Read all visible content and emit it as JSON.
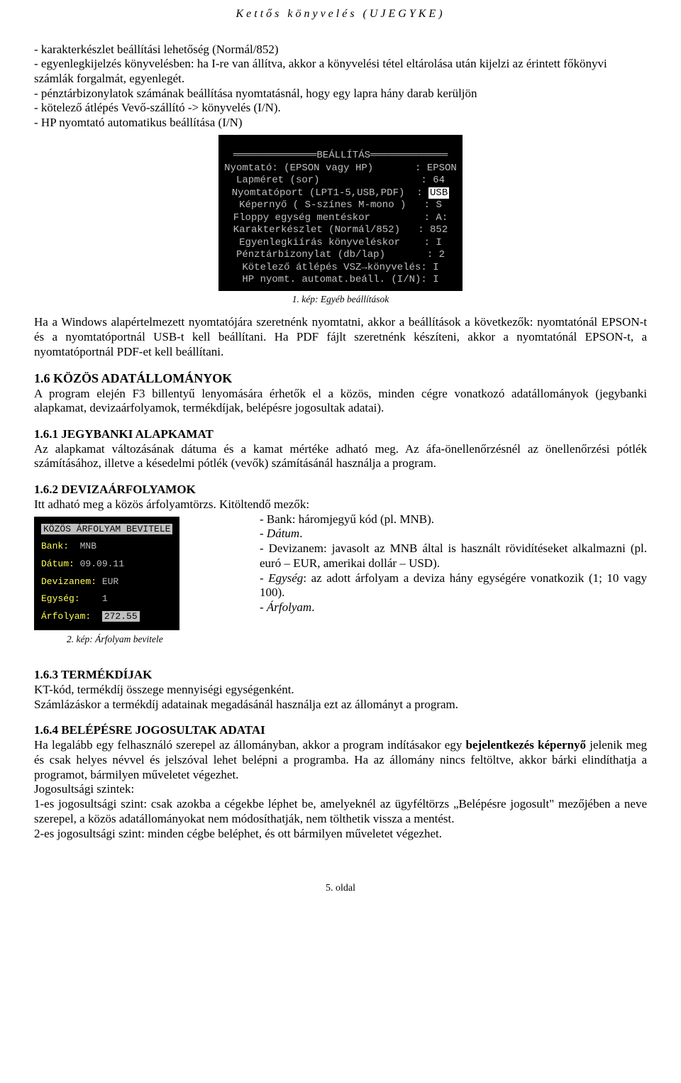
{
  "header": "Kettős könyvelés (UJEGYKE)",
  "intro_bullets": [
    "karakterkészlet beállítási lehetőség (Normál/852)",
    "egyenlegkijelzés könyvelésben: ha I-re van állítva, akkor a könyvelési tétel eltárolása után kijelzi az érintett főkönyvi számlák forgalmát, egyenlegét.",
    "pénztárbizonylatok számának beállítása nyomtatásnál, hogy egy lapra hány darab kerüljön",
    "kötelező átlépés Vevő-szállító -> könyvelés (I/N).",
    "HP nyomtató automatikus beállítása (I/N)"
  ],
  "dos1": {
    "title": "══════════════BEÁLLÍTÁS═════════════",
    "rows": [
      {
        "label": "Nyomtató: (EPSON vagy HP)",
        "sep": ":",
        "val": "EPSON"
      },
      {
        "label": "Lapméret (sor)",
        "sep": ":",
        "val": "64"
      },
      {
        "label": "Nyomtatóport (LPT1-5,USB,PDF)",
        "sep": ":",
        "val": "USB",
        "hl": true
      },
      {
        "label": "Képernyő ( S-színes M-mono )",
        "sep": ":",
        "val": "S"
      },
      {
        "label": "Floppy egység mentéskor",
        "sep": ":",
        "val": "A:"
      },
      {
        "label": "Karakterkészlet (Normál/852)",
        "sep": ":",
        "val": "852"
      },
      {
        "label": "Egyenlegkiírás könyveléskor",
        "sep": ":",
        "val": "I"
      },
      {
        "label": "Pénztárbizonylat (db/lap)",
        "sep": ":",
        "val": "2"
      },
      {
        "label": "Kötelező átlépés VSZ→könyvelés:",
        "sep": "",
        "val": "I"
      },
      {
        "label": "HP nyomt. automat.beáll. (I/N):",
        "sep": "",
        "val": "I"
      }
    ]
  },
  "caption1": "1. kép: Egyéb beállítások",
  "para1": "Ha a Windows alapértelmezett nyomtatójára szeretnénk nyomtatni, akkor a beállítások a következők: nyomtatónál EPSON-t és a nyomtatóportnál USB-t kell beállítani. Ha PDF fájlt szeretnénk készíteni, akkor a nyomtatónál EPSON-t, a nyomtatóportnál PDF-et kell beállítani.",
  "sec16_title": "1.6   KÖZÖS ADATÁLLOMÁNYOK",
  "sec16_body": "A program elején F3 billentyű lenyomására érhetők el a közös, minden cégre vonatkozó adatállományok (jegybanki alapkamat, devizaárfolyamok, termékdíjak, belépésre jogosultak adatai).",
  "sec161_title": "1.6.1  JEGYBANKI ALAPKAMAT",
  "sec161_body": "Az alapkamat változásának dátuma és a kamat mértéke adható meg. Az áfa-önellenőrzésnél az önellenőrzési pótlék számításához, illetve a késedelmi pótlék (vevők) számításánál használja a program.",
  "sec162_title": "1.6.2  DEVIZAÁRFOLYAMOK",
  "sec162_lead": "Itt adható meg a közös árfolyamtörzs. Kitöltendő mezők:",
  "dos2": {
    "title": "KÖZÖS ÁRFOLYAM BEVITELE",
    "rows": [
      {
        "k": "Bank:",
        "v": "MNB"
      },
      {
        "k": "Dátum:",
        "v": "09.09.11"
      },
      {
        "k": "Devizanem:",
        "v": "EUR"
      },
      {
        "k": "Egység:",
        "v": "1"
      },
      {
        "k": "Árfolyam:",
        "v": "272.55"
      }
    ]
  },
  "caption2": "2. kép: Árfolyam bevitele",
  "right_items": {
    "bank": "- Bank: háromjegyű kód (pl. MNB).",
    "datum": "Dátum",
    "devizanem": "- Devizanem: javasolt az MNB által is használt rövidítéseket alkalmazni (pl. euró – EUR, amerikai dollár – USD).",
    "egyseg_label": "Egység",
    "egyseg_rest": ": az adott árfolyam a deviza hány egységére vonatkozik (1; 10 vagy 100).",
    "arfolyam": "Árfolyam"
  },
  "sec163_title": "1.6.3  TERMÉKDÍJAK",
  "sec163_l1": "KT-kód, termékdíj összege mennyiségi egységenként.",
  "sec163_l2": "Számlázáskor a termékdíj adatainak megadásánál használja ezt az állományt a program.",
  "sec164_title": "1.6.4  BELÉPÉSRE JOGOSULTAK ADATAI",
  "sec164_p1a": "Ha legalább egy felhasználó szerepel az állományban, akkor a program indításakor egy ",
  "sec164_p1b": "bejelentkezés képernyő",
  "sec164_p1c": " jelenik meg és csak helyes névvel és jelszóval lehet belépni a programba. Ha az állomány nincs feltöltve, akkor bárki elindíthatja a programot, bármilyen műveletet végezhet.",
  "sec164_jog": "Jogosultsági szintek:",
  "sec164_l1": "1-es jogosultsági szint: csak azokba a cégekbe léphet be, amelyeknél az ügyféltörzs „Belépésre jogosult\" mezőjében a neve szerepel, a közös adatállományokat nem módosíthatják, nem tölthetik vissza a mentést.",
  "sec164_l2": "2-es jogosultsági szint: minden cégbe beléphet, és ott bármilyen műveletet végezhet.",
  "footer": "5. oldal"
}
